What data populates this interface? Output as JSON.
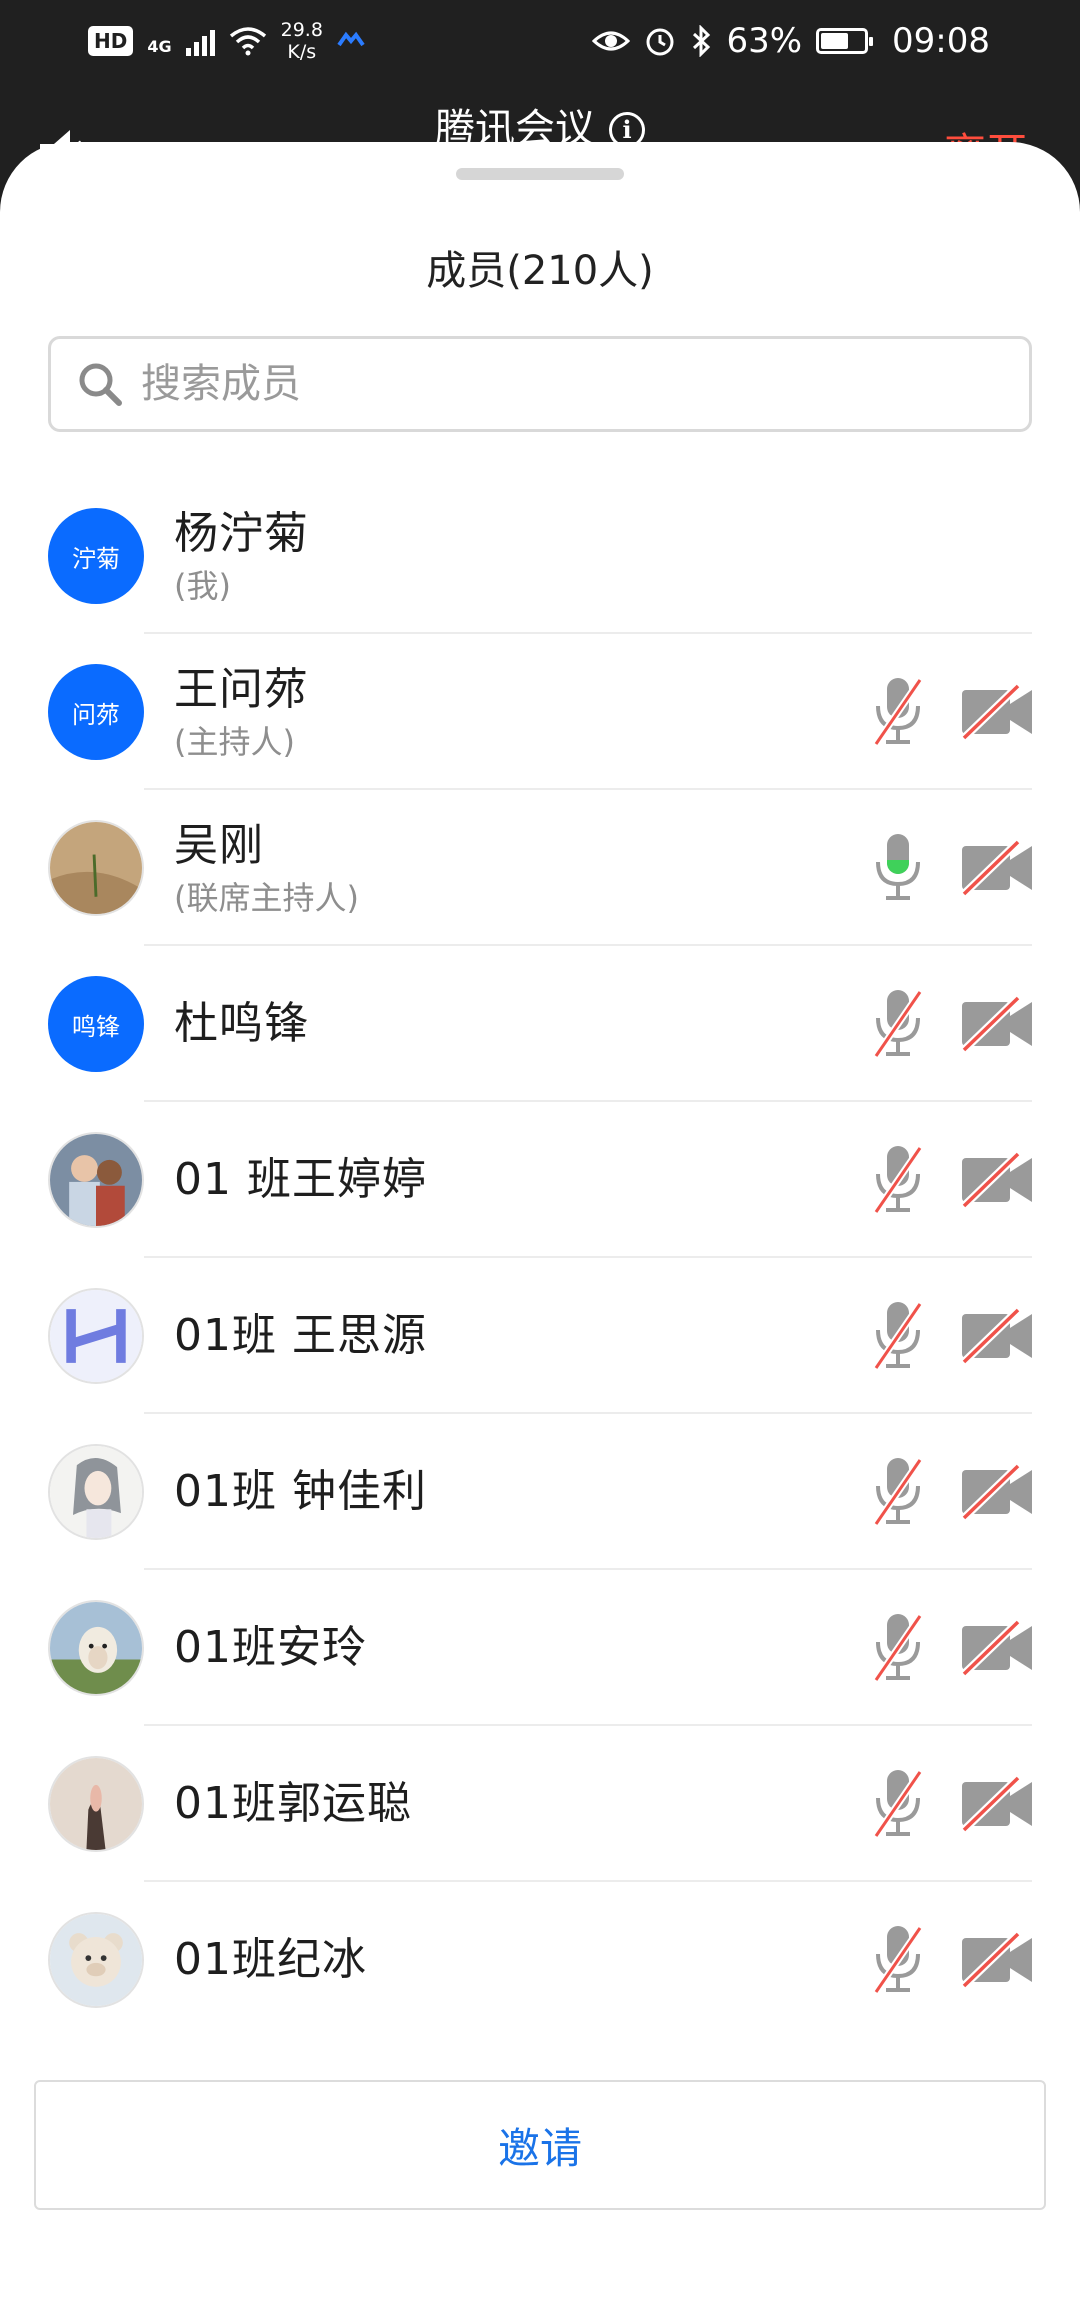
{
  "status_bar": {
    "hd": "HD",
    "net": "4G",
    "speed_value": "29.8",
    "speed_unit": "K/s",
    "battery": "63%",
    "time": "09:08"
  },
  "header": {
    "title": "腾讯会议",
    "leave_label": "离开"
  },
  "sheet": {
    "title": "成员(210人)",
    "search_placeholder": "搜索成员",
    "invite_label": "邀请"
  },
  "members": [
    {
      "name": "杨泞菊",
      "role": "(我)",
      "avatar_text": "泞菊",
      "avatar_type": "text",
      "show_controls": false
    },
    {
      "name": "王问茒",
      "role": "(主持人)",
      "avatar_text": "问茒",
      "avatar_type": "text",
      "show_controls": true,
      "mic": "muted",
      "camera": "off"
    },
    {
      "name": "吴刚",
      "role": "(联席主持人)",
      "avatar_text": "",
      "avatar_type": "photo-sand",
      "show_controls": true,
      "mic": "speaking",
      "camera": "off"
    },
    {
      "name": " 杜鸣锋",
      "role": "",
      "avatar_text": "鸣锋",
      "avatar_type": "text",
      "show_controls": true,
      "mic": "muted",
      "camera": "off"
    },
    {
      "name": "01 班王婷婷",
      "role": "",
      "avatar_text": "",
      "avatar_type": "photo-couple",
      "show_controls": true,
      "mic": "muted",
      "camera": "off"
    },
    {
      "name": "01班 王思源",
      "role": "",
      "avatar_text": "",
      "avatar_type": "photo-logo",
      "show_controls": true,
      "mic": "muted",
      "camera": "off"
    },
    {
      "name": "01班 钟佳利",
      "role": "",
      "avatar_text": "",
      "avatar_type": "photo-anime",
      "show_controls": true,
      "mic": "muted",
      "camera": "off"
    },
    {
      "name": "01班安玲",
      "role": "",
      "avatar_text": "",
      "avatar_type": "photo-sheep",
      "show_controls": true,
      "mic": "muted",
      "camera": "off"
    },
    {
      "name": "01班郭运聪",
      "role": "",
      "avatar_text": "",
      "avatar_type": "photo-hand",
      "show_controls": true,
      "mic": "muted",
      "camera": "off"
    },
    {
      "name": "01班纪冰",
      "role": "",
      "avatar_text": "",
      "avatar_type": "photo-bear",
      "show_controls": true,
      "mic": "muted",
      "camera": "off"
    }
  ],
  "colors": {
    "accent_blue": "#0a6bff",
    "invite_text": "#1a73e8",
    "leave_red": "#ff4d3d",
    "mute_slash": "#f0524a",
    "speaking_green": "#3fd15a",
    "icon_gray": "#9a9a9a"
  }
}
